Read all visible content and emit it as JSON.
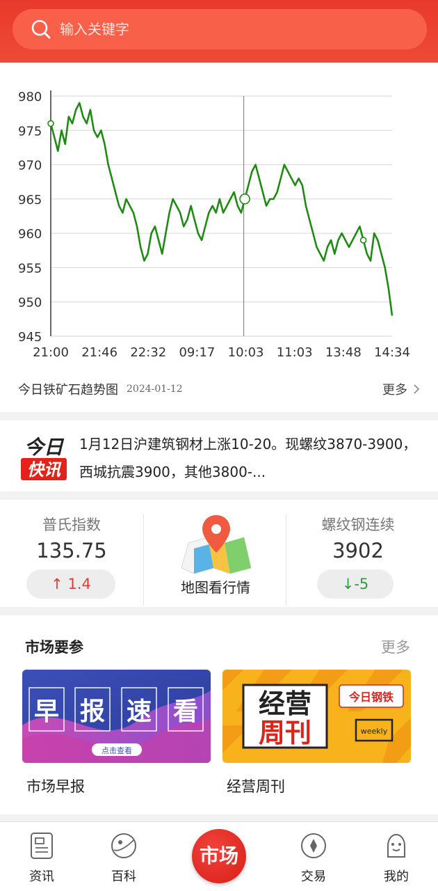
{
  "search": {
    "placeholder": "输入关键字"
  },
  "chart_data": {
    "type": "line",
    "x_ticks": [
      "21:00",
      "21:46",
      "22:32",
      "09:17",
      "10:03",
      "11:03",
      "13:48",
      "14:34"
    ],
    "y_ticks": [
      945,
      950,
      955,
      960,
      965,
      970,
      975,
      980
    ],
    "ylim": [
      945,
      980
    ],
    "grid": true,
    "series": [
      {
        "color": "#1f8a12",
        "values": [
          976,
          974,
          972,
          975,
          973,
          977,
          976,
          978,
          979,
          977,
          976,
          978,
          975,
          974,
          975,
          973,
          970,
          968,
          966,
          964,
          963,
          965,
          964,
          963,
          961,
          958,
          956,
          957,
          960,
          961,
          959,
          957,
          960,
          963,
          965,
          964,
          963,
          961,
          962,
          964,
          962,
          960,
          959,
          961,
          963,
          964,
          963,
          965,
          963,
          964,
          965,
          966,
          964,
          963,
          965,
          967,
          969,
          970,
          968,
          966,
          964,
          965,
          965,
          966,
          968,
          970,
          969,
          968,
          967,
          968,
          967,
          964,
          962,
          960,
          958,
          957,
          956,
          958,
          959,
          957,
          959,
          960,
          959,
          958,
          959,
          960,
          961,
          959,
          957,
          956,
          960,
          959,
          957,
          955,
          952,
          948
        ]
      }
    ],
    "markers": [
      {
        "label": "open",
        "value": 976
      },
      {
        "label": "cursor",
        "value": 965
      },
      {
        "label": "low",
        "value": 956
      }
    ],
    "crosshair_x_label": "10:03"
  },
  "chart_footer": {
    "title": "今日铁矿石趋势图",
    "date": "2024-01-12",
    "more": "更多"
  },
  "news": {
    "logo_top": "今日",
    "logo_bottom": "快讯",
    "text": "1月12日沪建筑钢材上涨10-20。现螺纹3870-3900，西城抗震3900，其他3800-..."
  },
  "stats": {
    "left": {
      "label": "普氏指数",
      "value": "135.75",
      "change_arrow": "↑",
      "change": "1.4",
      "color": "#e53935"
    },
    "middle": {
      "label": "地图看行情"
    },
    "right": {
      "label": "螺纹钢连续",
      "value": "3902",
      "change_arrow": "↓",
      "change": "-5",
      "color": "#2e9e3d"
    }
  },
  "market": {
    "title": "市场要参",
    "more": "更多",
    "cards": [
      {
        "label": "市场早报",
        "banner_chars": [
          "早",
          "报",
          "速",
          "看"
        ],
        "banner_button": "点击查看"
      },
      {
        "label": "经营周刊",
        "banner_top": "经营",
        "banner_bottom": "周刊",
        "badge": "今日钢铁",
        "sub": "weekly"
      }
    ]
  },
  "nav": {
    "tabs": [
      {
        "label": "资讯",
        "icon": "document-icon"
      },
      {
        "label": "百科",
        "icon": "planet-icon"
      },
      {
        "label": "市场",
        "icon": "market-center-button"
      },
      {
        "label": "交易",
        "icon": "diamond-icon"
      },
      {
        "label": "我的",
        "icon": "user-icon"
      }
    ]
  }
}
